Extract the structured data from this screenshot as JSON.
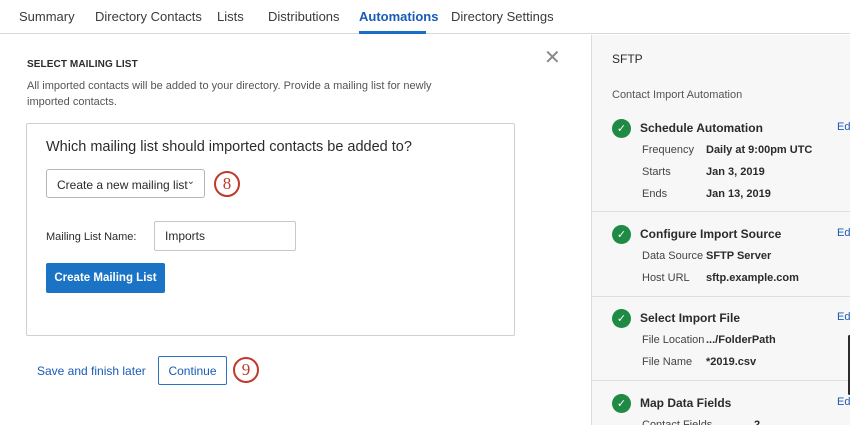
{
  "tabs": [
    {
      "label": "Summary"
    },
    {
      "label": "Directory Contacts"
    },
    {
      "label": "Lists"
    },
    {
      "label": "Distributions"
    },
    {
      "label": "Automations"
    },
    {
      "label": "Directory Settings"
    }
  ],
  "left": {
    "section_title": "SELECT MAILING LIST",
    "section_desc": "All imported contacts will be added to your directory. Provide a mailing list for newly imported contacts.",
    "close_icon": "close-icon",
    "card": {
      "question": "Which mailing list should imported contacts be added to?",
      "dropdown_value": "Create a new mailing list",
      "dropdown_chevron": "⌄",
      "name_label": "Mailing List Name:",
      "name_value": "Imports",
      "create_button": "Create Mailing List"
    },
    "callout_8": "8",
    "callout_9": "9",
    "save_link": "Save and finish later",
    "continue_button": "Continue"
  },
  "right": {
    "title": "SFTP",
    "subtitle": "Contact Import Automation",
    "edit_label": "Ed",
    "steps": [
      {
        "title": "Schedule Automation",
        "rows": [
          {
            "key": "Frequency",
            "value": "Daily at 9:00pm UTC"
          },
          {
            "key": "Starts",
            "value": "Jan 3, 2019"
          },
          {
            "key": "Ends",
            "value": "Jan 13, 2019"
          }
        ]
      },
      {
        "title": "Configure Import Source",
        "rows": [
          {
            "key": "Data Source",
            "value": "SFTP Server"
          },
          {
            "key": "Host URL",
            "value": "sftp.example.com"
          }
        ]
      },
      {
        "title": "Select Import File",
        "rows": [
          {
            "key": "File Location",
            "value": ".../FolderPath"
          },
          {
            "key": "File Name",
            "value": "*2019.csv"
          }
        ]
      },
      {
        "title": "Map Data Fields",
        "rows": [
          {
            "key": "Contact Fields",
            "value": "2"
          }
        ]
      }
    ]
  },
  "colors": {
    "accent": "#1a73c5",
    "active_tab": "#1a5bb5",
    "success": "#1e8a43",
    "callout": "#c0392b"
  }
}
